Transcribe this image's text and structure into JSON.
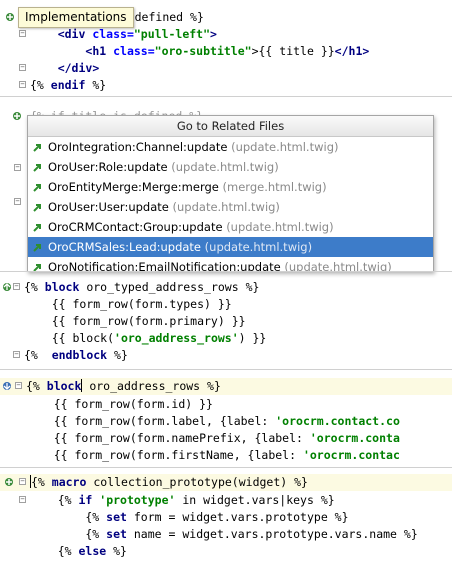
{
  "tooltip": {
    "text": "Implementations"
  },
  "panel1": {
    "lines": [
      {
        "a": "{% ",
        "b": "s defined %}"
      },
      {
        "indent": "    ",
        "open": "<div ",
        "attr": "class=",
        "val": "\"pull-left\"",
        "close": ">"
      },
      {
        "indent": "        ",
        "open": "<h1 ",
        "attr": "class=",
        "val": "\"oro-subtitle\"",
        "mid": ">{{ title }}",
        "close": "</h1>"
      },
      {
        "indent": "    ",
        "close": "</div>"
      },
      {
        "pre": "{% ",
        "kw": "endif",
        "post": " %}"
      }
    ]
  },
  "panel2": {
    "partial_line": "{% if title is defined %}"
  },
  "popup": {
    "title": "Go to Related Files",
    "items": [
      {
        "name": "OroIntegration:Channel:update",
        "path": "(update.html.twig)",
        "selected": false
      },
      {
        "name": "OroUser:Role:update",
        "path": "(update.html.twig)",
        "selected": false
      },
      {
        "name": "OroEntityMerge:Merge:merge",
        "path": "(merge.html.twig)",
        "selected": false
      },
      {
        "name": "OroUser:User:update",
        "path": "(update.html.twig)",
        "selected": false
      },
      {
        "name": "OroCRMContact:Group:update",
        "path": "(update.html.twig)",
        "selected": false
      },
      {
        "name": "OroCRMSales:Lead:update",
        "path": "(update.html.twig)",
        "selected": true
      },
      {
        "name": "OroNotification:EmailNotification:update",
        "path": "(update.html.twig)",
        "selected": false
      }
    ]
  },
  "panel3": {
    "lines": [
      {
        "pre": "{% ",
        "kw": "block",
        "post": " oro_typed_address_rows %}"
      },
      {
        "pre": "    {{ form_row(form.types) }}"
      },
      {
        "pre": "    {{ form_row(form.primary) }}"
      },
      {
        "pre": "    {{ block(",
        "str": "'oro_address_rows'",
        "post": ") }}"
      },
      {
        "pre": "{%  ",
        "kw": "endblock",
        "post": " %}"
      }
    ]
  },
  "panel4": {
    "lines": [
      {
        "pre": "{% ",
        "kw": "block",
        "post": " oro_address_rows %}"
      },
      {
        "pre": "    {{ form_row(form.id) }}"
      },
      {
        "pre": "    {{ form_row(form.label, {label: ",
        "str": "'orocrm.contact.co"
      },
      {
        "pre": "    {{ form_row(form.namePrefix, {label: ",
        "str": "'orocrm.conta"
      },
      {
        "pre": "    {{ form_row(form.firstName, {label: ",
        "str": "'orocrm.contac"
      }
    ]
  },
  "panel5": {
    "lines": [
      {
        "pre": "{% ",
        "kw": "macro",
        "post": " collection_prototype(widget) %}"
      },
      {
        "pre": "    {% ",
        "kw": "if",
        "mid": " ",
        "str": "'prototype'",
        "post": " in widget.vars|keys %}"
      },
      {
        "pre": "        {% ",
        "kw": "set",
        "post": " form = widget.vars.prototype %}"
      },
      {
        "pre": "        {% ",
        "kw": "set",
        "post": " name = widget.vars.prototype.vars.name %}"
      },
      {
        "pre": "    {% ",
        "kw": "else",
        "post": " %}"
      }
    ]
  },
  "colors": {
    "keyword": "#000080",
    "string": "#008000",
    "attr": "#0000ff",
    "selection": "#3d7cc9",
    "line_highlight": "#fcfae2",
    "tooltip_bg": "#fdfbd8"
  }
}
